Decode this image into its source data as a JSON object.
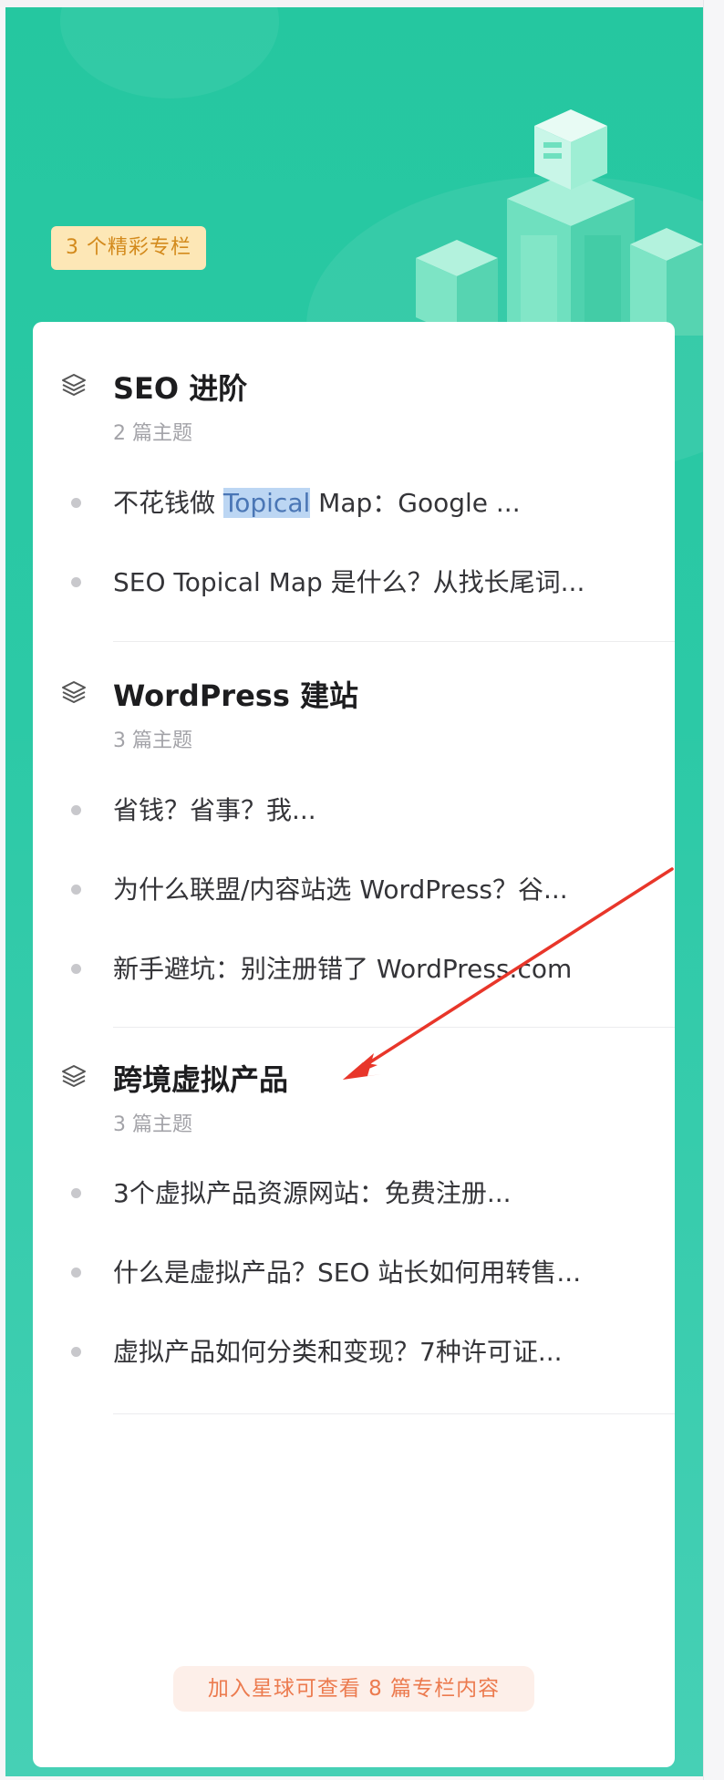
{
  "badge": "3 个精彩专栏",
  "sections": [
    {
      "title": "SEO 进阶",
      "subtitle": "2 篇主题",
      "items": [
        {
          "before": "不花钱做 ",
          "highlight": "Topical",
          "after": " Map：Google ..."
        },
        {
          "text": "SEO Topical Map 是什么？从找长尾词..."
        }
      ]
    },
    {
      "title": "WordPress 建站",
      "subtitle": "3 篇主题",
      "items": [
        {
          "text": "省钱？省事？我..."
        },
        {
          "text": "为什么联盟/内容站选 WordPress？谷..."
        },
        {
          "text": "新手避坑：别注册错了 WordPress.com"
        }
      ]
    },
    {
      "title": "跨境虚拟产品",
      "subtitle": "3 篇主题",
      "items": [
        {
          "text": "3个虚拟产品资源网站：免费注册..."
        },
        {
          "text": "什么是虚拟产品？SEO 站长如何用转售..."
        },
        {
          "text": "虚拟产品如何分类和变现？7种许可证..."
        }
      ]
    }
  ],
  "join_button": "加入星球可查看 8 篇专栏内容",
  "icons": {
    "section": "layers-icon",
    "annotation": "red-arrow"
  },
  "colors": {
    "panel": "#2cc9a6",
    "badge_bg": "#fde7b6",
    "badge_text": "#d38a1c",
    "join_bg": "#fdefe9",
    "join_text": "#ec7b4f",
    "highlight": "#bcd6f3",
    "arrow": "#e8362a"
  }
}
